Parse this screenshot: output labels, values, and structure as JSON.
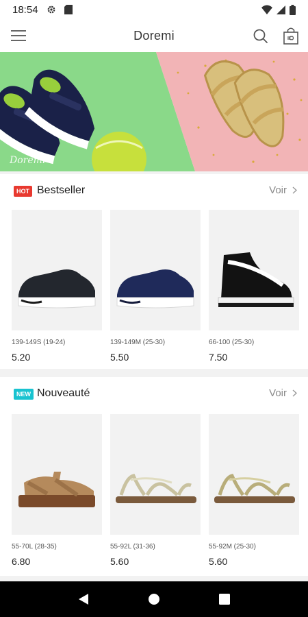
{
  "status_bar": {
    "time": "18:54"
  },
  "app_bar": {
    "title": "Doremi"
  },
  "banner": {
    "watermark": "Doremi"
  },
  "sections": [
    {
      "badge": "HOT",
      "title": "Bestseller",
      "more_label": "Voir",
      "products": [
        {
          "sku": "139-149S (19-24)",
          "price": "5.20"
        },
        {
          "sku": "139-149M (25-30)",
          "price": "5.50"
        },
        {
          "sku": "66-100 (25-30)",
          "price": "7.50"
        }
      ]
    },
    {
      "badge": "NEW",
      "title": "Nouveauté",
      "more_label": "Voir",
      "products": [
        {
          "sku": "55-70L (28-35)",
          "price": "6.80"
        },
        {
          "sku": "55-92L (31-36)",
          "price": "5.60"
        },
        {
          "sku": "55-92M (25-30)",
          "price": "5.60"
        }
      ]
    }
  ],
  "colors": {
    "hot_badge": "#e8392f",
    "new_badge": "#18c3d0",
    "banner_green": "#8ad989",
    "banner_pink": "#f2b4b6"
  }
}
